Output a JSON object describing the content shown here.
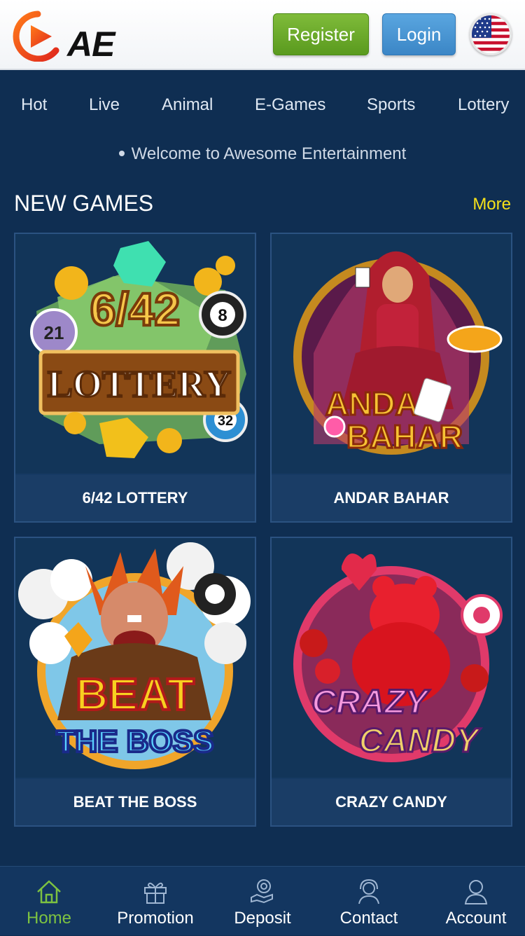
{
  "header": {
    "logo_text": "AE",
    "register_label": "Register",
    "login_label": "Login",
    "language_flag": "us-flag-icon"
  },
  "nav": {
    "tabs": [
      {
        "label": "Hot"
      },
      {
        "label": "Live"
      },
      {
        "label": "Animal"
      },
      {
        "label": "E-Games"
      },
      {
        "label": "Sports"
      },
      {
        "label": "Lottery"
      }
    ]
  },
  "marquee": {
    "text": "Welcome to Awesome Entertainment"
  },
  "section": {
    "title": "NEW GAMES",
    "more_label": "More"
  },
  "games": [
    {
      "title": "6/42 LOTTERY",
      "art_line1": "6/42",
      "art_line2": "LOTTERY"
    },
    {
      "title": "ANDAR BAHAR",
      "art_line1": "ANDAR",
      "art_line2": "BAHAR"
    },
    {
      "title": "BEAT THE BOSS",
      "art_line1": "BEAT",
      "art_line2": "THE BOSS"
    },
    {
      "title": "CRAZY CANDY",
      "art_line1": "CRAZY",
      "art_line2": "CANDY"
    }
  ],
  "bottom_nav": [
    {
      "label": "Home",
      "icon": "home-icon",
      "active": true
    },
    {
      "label": "Promotion",
      "icon": "gift-icon",
      "active": false
    },
    {
      "label": "Deposit",
      "icon": "deposit-icon",
      "active": false
    },
    {
      "label": "Contact",
      "icon": "headset-icon",
      "active": false
    },
    {
      "label": "Account",
      "icon": "user-icon",
      "active": false
    }
  ],
  "colors": {
    "background": "#0f2e52",
    "accent_green": "#7dc241",
    "more_yellow": "#f5e11a",
    "register_green": "#6aab2a",
    "login_blue": "#4a96d4"
  }
}
